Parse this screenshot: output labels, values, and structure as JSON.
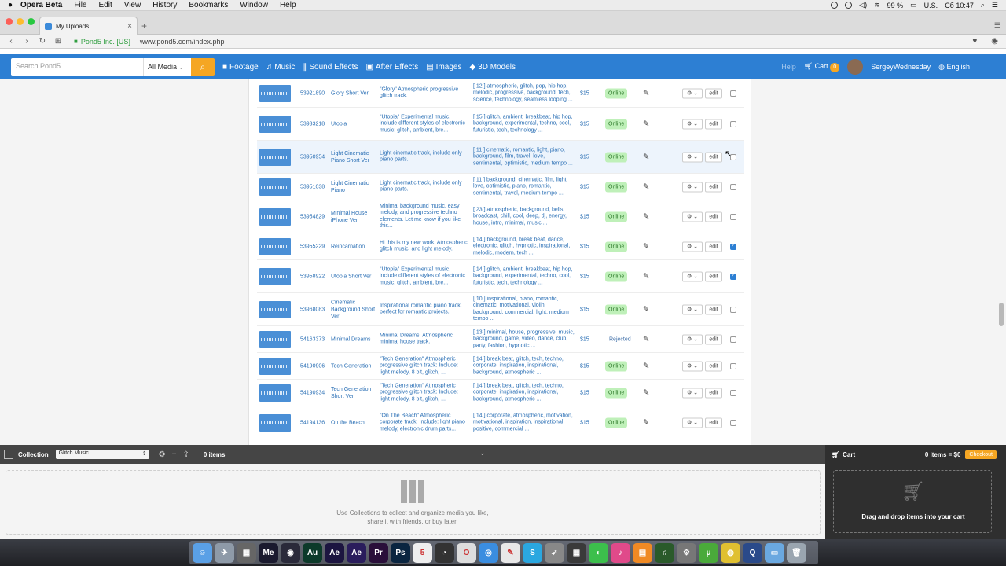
{
  "menubar": {
    "app": "Opera Beta",
    "items": [
      "File",
      "Edit",
      "View",
      "History",
      "Bookmarks",
      "Window",
      "Help"
    ],
    "battery": "99 %",
    "input_source": "U.S.",
    "clock": "Сб 10:47"
  },
  "browser": {
    "tab_title": "My Uploads",
    "org": "Pond5 Inc. [US]",
    "url": "www.pond5.com/index.php"
  },
  "sitenav": {
    "search_placeholder": "Search Pond5...",
    "media_select": "All Media",
    "links": [
      {
        "label": "Footage",
        "icon": "video-camera-icon",
        "glyph": "■"
      },
      {
        "label": "Music",
        "icon": "music-note-icon",
        "glyph": "♫"
      },
      {
        "label": "Sound Effects",
        "icon": "waveform-icon",
        "glyph": "∥"
      },
      {
        "label": "After Effects",
        "icon": "after-effects-icon",
        "glyph": "▣"
      },
      {
        "label": "Images",
        "icon": "image-icon",
        "glyph": "▤"
      },
      {
        "label": "3D Models",
        "icon": "cube-icon",
        "glyph": "◆"
      }
    ],
    "help": "Help",
    "cart": "Cart",
    "cart_count": "0",
    "username": "SergeyWednesday",
    "language": "English"
  },
  "uploads": {
    "edit_label": "edit",
    "rows": [
      {
        "id": "53921890",
        "title": "Glory Short Ver",
        "desc": "\"Glory\" Atmospheric progressive glitch track.",
        "keywords": "[ 12 ] atmospheric, glitch, pop, hip hop, melodic, progressive, background, tech, science, technology, seamless looping ...",
        "price": "$15",
        "status": "Online",
        "checked": false
      },
      {
        "id": "53933218",
        "title": "Utopia",
        "desc": "\"Utopia\" Experimental music, include different styles of electronic music: glitch, ambient, bre...",
        "keywords": "[ 15 ] glitch, ambient, breakbeat, hip hop, background, experimental, techno, cool, futuristic, tech, technology ...",
        "price": "$15",
        "status": "Online",
        "checked": false
      },
      {
        "id": "53950954",
        "title": "Light Cinematic Piano Short Ver",
        "desc": "Light cinematic track, include only piano parts.",
        "keywords": "[ 11 ] cinematic, romantic, light, piano, background, film, travel, love, sentimental, optimistic, medium tempo ...",
        "price": "$15",
        "status": "Online",
        "checked": false
      },
      {
        "id": "53951038",
        "title": "Light Cinematic Piano",
        "desc": "Light cinematic track, include only piano parts.",
        "keywords": "[ 11 ] background, cinematic, film, light, love, optimistic, piano, romantic, sentimental, travel, medium tempo ...",
        "price": "$15",
        "status": "Online",
        "checked": false
      },
      {
        "id": "53954829",
        "title": "Minimal House iPhone Ver",
        "desc": "Minimal background music, easy melody, and progressive techno elements. Let me know if you like this...",
        "keywords": "[ 23 ] atmospheric, background, bells, broadcast, chill, cool, deep, dj, energy, house, intro, minimal, music ...",
        "price": "$15",
        "status": "Online",
        "checked": false
      },
      {
        "id": "53955229",
        "title": "Reincarnation",
        "desc": "Hi this is my new work. Atmospheric glitch music, and light melody.",
        "keywords": "[ 14 ] background, break beat, dance, electronic, glitch, hypnotic, inspirational, melodic, modern, tech ...",
        "price": "$15",
        "status": "Online",
        "checked": true
      },
      {
        "id": "53958922",
        "title": "Utopia Short Ver",
        "desc": "\"Utopia\" Experimental music, include different styles of electronic music: glitch, ambient, bre...",
        "keywords": "[ 14 ] glitch, ambient, breakbeat, hip hop, background, experimental, techno, cool, futuristic, tech, technology ...",
        "price": "$15",
        "status": "Online",
        "checked": true
      },
      {
        "id": "53968083",
        "title": "Cinematic Background Short Ver",
        "desc": "Inspirational romantic piano track, perfect for romantic projects.",
        "keywords": "[ 10 ] inspirational, piano, romantic, cinematic, motivational, violin, background, commercial, light, medium tempo ...",
        "price": "$15",
        "status": "Online",
        "checked": false
      },
      {
        "id": "54163373",
        "title": "Minimal Dreams",
        "desc": "Minimal Dreams. Atmospheric minimal house track.",
        "keywords": "[ 13 ] minimal, house, progressive, music, background, game, video, dance, club, party, fashion, hypnotic ...",
        "price": "$15",
        "status": "Rejected",
        "checked": false
      },
      {
        "id": "54190906",
        "title": "Tech Generation",
        "desc": "\"Tech Generation\" Atmospheric progressive glitch track: Include: light melody, 8 bit, glitch, ...",
        "keywords": "[ 14 ] break beat, glitch, tech, techno, corporate, inspiration, inspirational, background, atmospheric ...",
        "price": "$15",
        "status": "Online",
        "checked": false
      },
      {
        "id": "54190934",
        "title": "Tech Generation Short Ver",
        "desc": "\"Tech Generation\" Atmospheric progressive glitch track: Include: light melody, 8 bit, glitch, ...",
        "keywords": "[ 14 ] break beat, glitch, tech, techno, corporate, inspiration, inspirational, background, atmospheric ...",
        "price": "$15",
        "status": "Online",
        "checked": false
      },
      {
        "id": "54194136",
        "title": "On the Beach",
        "desc": "\"On The Beach\" Atmospheric corporate track: Include: light piano melody, electronic drum parts...",
        "keywords": "[ 14 ] corporate, atmospheric, motivation, motivational, inspiration, inspirational, positive, commercial ...",
        "price": "$15",
        "status": "Online",
        "checked": false
      }
    ]
  },
  "collection": {
    "label": "Collection",
    "selected": "Glitch Music",
    "count": "0 items",
    "empty_text_1": "Use Collections to collect and organize media you like,",
    "empty_text_2": "share it with friends, or buy later."
  },
  "cart_panel": {
    "label": "Cart",
    "summary": "0 items = $0",
    "checkout": "Checkout",
    "drop_text": "Drag and drop items into your cart"
  },
  "dock": {
    "apps": [
      {
        "name": "finder",
        "label": "☺",
        "color": "#5aa0e6"
      },
      {
        "name": "launchpad",
        "label": "✈",
        "color": "#8e9aa8"
      },
      {
        "name": "photo",
        "label": "▦",
        "color": "#666"
      },
      {
        "name": "media-encoder",
        "label": "Me",
        "color": "#1a1a2e"
      },
      {
        "name": "cinema",
        "label": "◉",
        "color": "#2a2a3a"
      },
      {
        "name": "audition",
        "label": "Au",
        "color": "#0c3a2a"
      },
      {
        "name": "after-effects",
        "label": "Ae",
        "color": "#1c1540"
      },
      {
        "name": "after-effects-2",
        "label": "Ae",
        "color": "#2a1d5c"
      },
      {
        "name": "premiere",
        "label": "Pr",
        "color": "#2a0f3a"
      },
      {
        "name": "photoshop",
        "label": "Ps",
        "color": "#0a2540"
      },
      {
        "name": "calendar",
        "label": "5",
        "color": "#eeeeee"
      },
      {
        "name": "clock",
        "label": "◔",
        "color": "#333"
      },
      {
        "name": "opera",
        "label": "O",
        "color": "#dddddd"
      },
      {
        "name": "safari",
        "label": "◎",
        "color": "#3a8de0"
      },
      {
        "name": "notes",
        "label": "✎",
        "color": "#e8e8e8"
      },
      {
        "name": "skype",
        "label": "S",
        "color": "#2aa7e0"
      },
      {
        "name": "rocket",
        "label": "➶",
        "color": "#888"
      },
      {
        "name": "grid",
        "label": "▦",
        "color": "#3a3a3a"
      },
      {
        "name": "facetime",
        "label": "◐",
        "color": "#3cbf4c"
      },
      {
        "name": "itunes",
        "label": "♪",
        "color": "#e04a8a"
      },
      {
        "name": "ibooks",
        "label": "▤",
        "color": "#f08a24"
      },
      {
        "name": "guitar",
        "label": "♫",
        "color": "#2a5a2a"
      },
      {
        "name": "preferences",
        "label": "⚙",
        "color": "#777"
      },
      {
        "name": "utorrent",
        "label": "μ",
        "color": "#4aaa3a"
      },
      {
        "name": "chrome",
        "label": "◍",
        "color": "#e0c030"
      },
      {
        "name": "quicktime",
        "label": "Q",
        "color": "#2a4a8a"
      },
      {
        "name": "folder",
        "label": "▭",
        "color": "#6aa8e0"
      },
      {
        "name": "trash",
        "label": "🗑",
        "color": "#9aa5b0"
      }
    ]
  }
}
